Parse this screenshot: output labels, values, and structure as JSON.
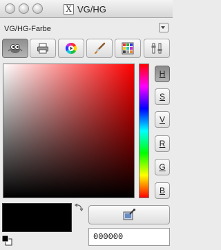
{
  "window": {
    "title": "VG/HG",
    "x11_glyph": "X"
  },
  "dock": {
    "title": "VG/HG-Farbe"
  },
  "selectors": [
    {
      "icon": "gimp-wilber-icon",
      "active": true
    },
    {
      "icon": "cmyk-printer-icon",
      "active": false
    },
    {
      "icon": "color-wheel-icon",
      "active": false
    },
    {
      "icon": "watercolor-brush-icon",
      "active": false
    },
    {
      "icon": "palette-grid-icon",
      "active": false
    },
    {
      "icon": "scales-icon",
      "active": false
    }
  ],
  "channels": [
    "H",
    "S",
    "V",
    "R",
    "G",
    "B"
  ],
  "active_channel": "H",
  "current": {
    "foreground": "#000000",
    "background": "#000000",
    "hex": "000000"
  },
  "colors": {
    "hue": "#ff0000",
    "window_bg": "#ebebeb"
  }
}
